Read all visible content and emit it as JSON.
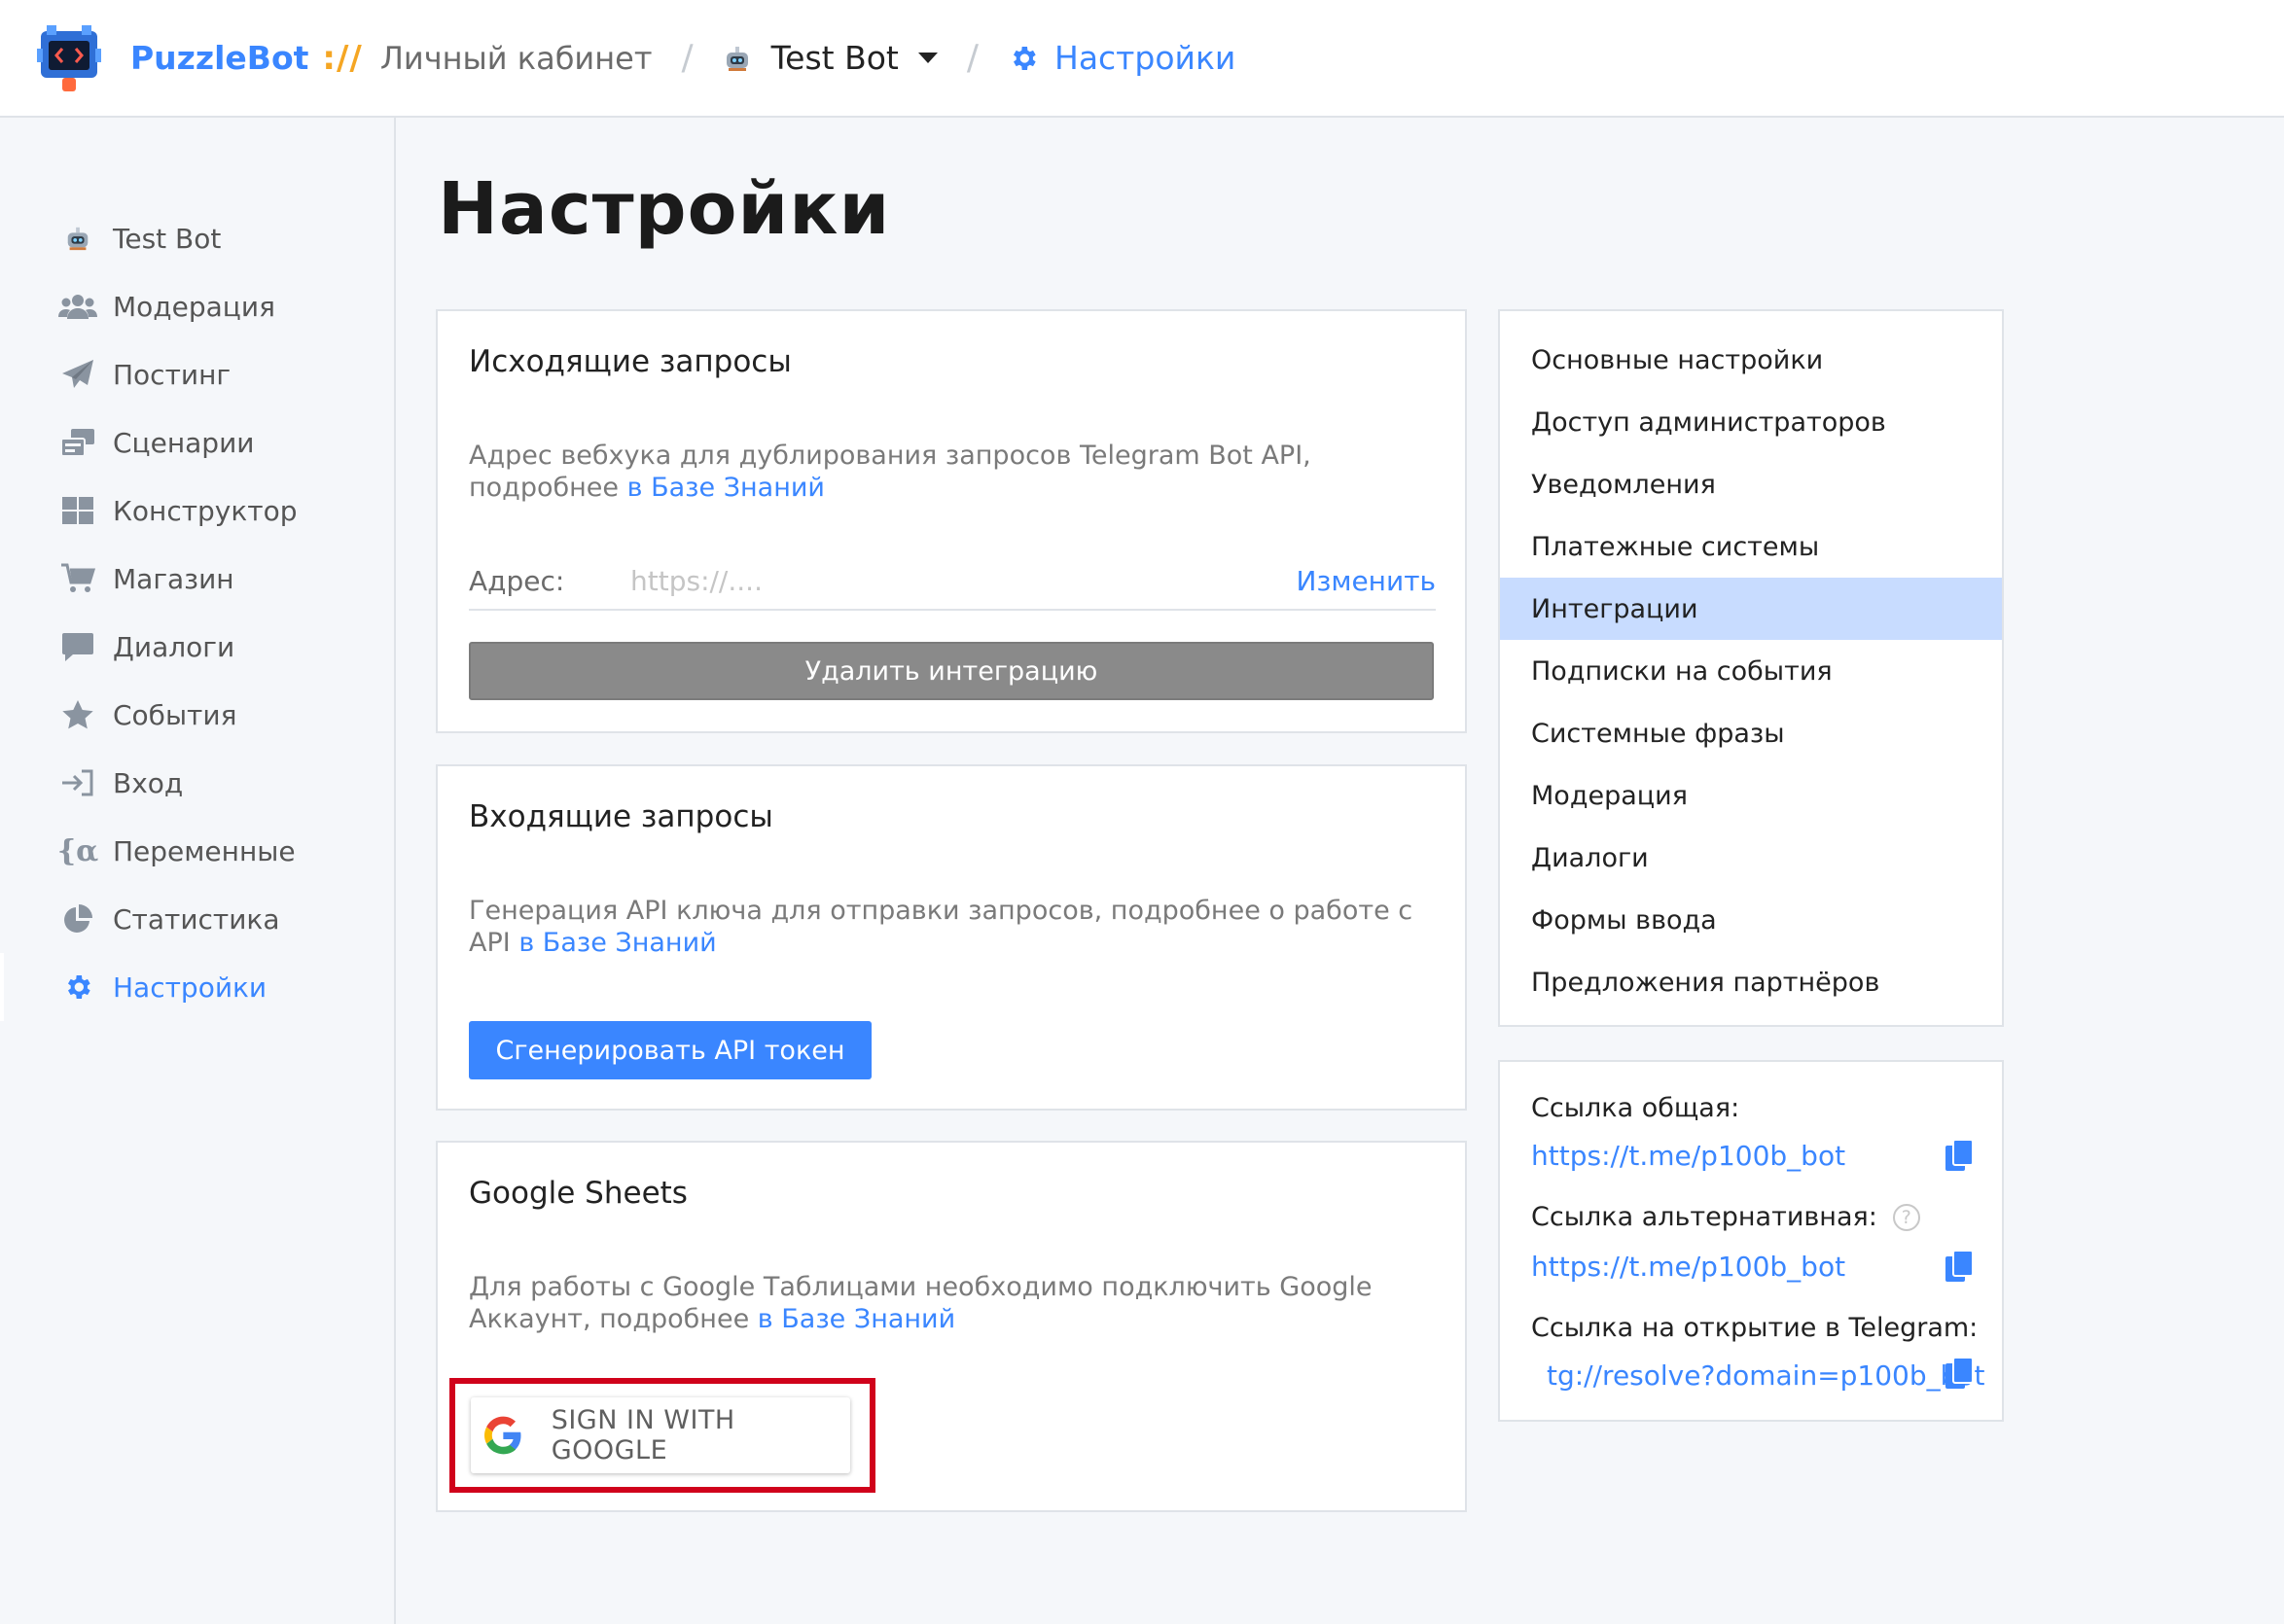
{
  "header": {
    "brand": "PuzzleBot",
    "brand_slash": "://",
    "cabinet": "Личный кабинет",
    "separator": "/",
    "bot_name": "Test Bot",
    "current": "Настройки"
  },
  "sidebar": {
    "items": [
      {
        "label": "Test Bot",
        "icon": "bot-icon"
      },
      {
        "label": "Модерация",
        "icon": "users-icon"
      },
      {
        "label": "Постинг",
        "icon": "paper-plane-icon"
      },
      {
        "label": "Сценарии",
        "icon": "scenarios-icon"
      },
      {
        "label": "Конструктор",
        "icon": "grid-icon"
      },
      {
        "label": "Магазин",
        "icon": "cart-icon"
      },
      {
        "label": "Диалоги",
        "icon": "chat-icon"
      },
      {
        "label": "События",
        "icon": "star-icon"
      },
      {
        "label": "Вход",
        "icon": "sign-in-icon"
      },
      {
        "label": "Переменные",
        "icon": "variable-icon"
      },
      {
        "label": "Статистика",
        "icon": "pie-chart-icon"
      },
      {
        "label": "Настройки",
        "icon": "gear-icon",
        "active": true
      }
    ]
  },
  "page": {
    "title": "Настройки"
  },
  "outgoing": {
    "title": "Исходящие запросы",
    "desc": "Адрес вебхука для дублирования запросов Telegram Bot API, подробнее ",
    "desc_link": "в Базе Знаний",
    "addr_label": "Адрес:",
    "addr_placeholder": "https://....",
    "change": "Изменить",
    "delete_button": "Удалить интеграцию"
  },
  "incoming": {
    "title": "Входящие запросы",
    "desc": "Генерация API ключа для отправки запросов, подробнее о работе с API ",
    "desc_link": "в Базе Знаний",
    "generate_button": "Сгенерировать API токен"
  },
  "gsheets": {
    "title": "Google Sheets",
    "desc": "Для работы с Google Таблицами необходимо подключить Google Аккаунт, подробнее ",
    "desc_link": "в Базе Знаний",
    "signin_button": "SIGN IN WITH GOOGLE"
  },
  "settings_menu": {
    "items": [
      "Основные настройки",
      "Доступ администраторов",
      "Уведомления",
      "Платежные системы",
      "Интеграции",
      "Подписки на события",
      "Системные фразы",
      "Модерация",
      "Диалоги",
      "Формы ввода",
      "Предложения партнёров"
    ],
    "selected": "Интеграции"
  },
  "links": {
    "general_label": "Ссылка общая:",
    "general_value": "https://t.me/p100b_bot",
    "alt_label": "Ссылка альтернативная:",
    "alt_help": "?",
    "alt_value": "https://t.me/p100b_bot",
    "tg_label": "Ссылка на открытие в Telegram:",
    "tg_value": "tg://resolve?domain=p100b_bot"
  },
  "colors": {
    "accent": "#3a86ff",
    "selected_bg": "#c8dcff",
    "highlight_frame": "#d0021b",
    "brand_slash": "#f5a623"
  }
}
